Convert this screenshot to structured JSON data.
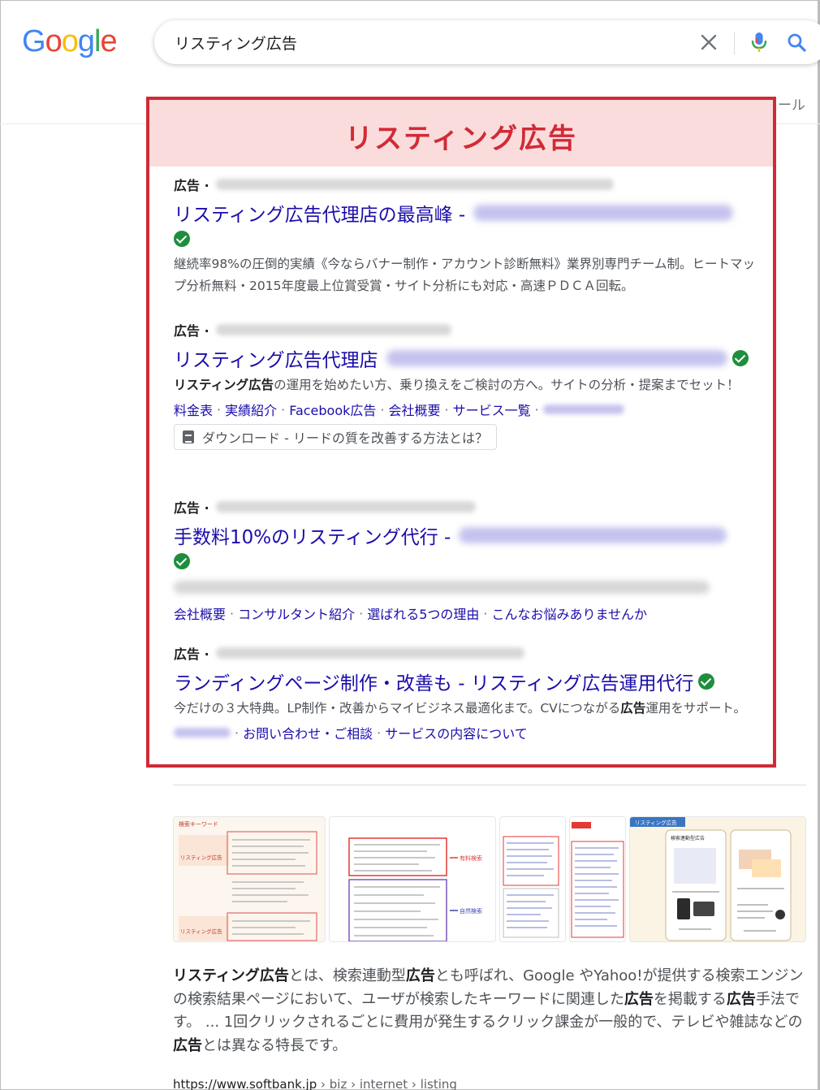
{
  "header": {
    "logo": {
      "letters": [
        "G",
        "o",
        "o",
        "g",
        "l",
        "e"
      ],
      "colors": [
        "#4285f4",
        "#ea4335",
        "#fbbc05",
        "#4285f4",
        "#34a853",
        "#ea4335"
      ]
    },
    "search_value": "リスティング広告",
    "tools_fragment": "ール"
  },
  "colors": {
    "accent_red": "#d12a36",
    "banner_bg": "#fbdcdc",
    "link_blue": "#1a0dab",
    "verified_green": "#1e8e3e"
  },
  "icons": {
    "clear": "close-icon",
    "mic": "mic-icon",
    "search": "search-icon",
    "verified": "check-icon",
    "download": "document-icon"
  },
  "banner": {
    "title": "リスティング広告"
  },
  "ads": [
    {
      "label": "広告 ·",
      "title": "リスティング広告代理店の最高峰 -",
      "desc": "継続率98%の圧倒的実績《今ならバナー制作・アカウント診断無料》業界別専門チーム制。ヒートマップ分析無料・2015年度最上位賞受賞・サイト分析にも対応・高速ＰＤＣＡ回転。"
    },
    {
      "label": "広告 ·",
      "title": "リスティング広告代理店",
      "desc_bold": "リスティング広告",
      "desc_rest": "の運用を始めたい方、乗り換えをご検討の方へ。サイトの分析・提案までセット！",
      "sitelinks": [
        "料金表",
        "実績紹介",
        "Facebook広告",
        "会社概要",
        "サービス一覧"
      ],
      "download": "ダウンロード - リードの質を改善する方法とは？"
    },
    {
      "label": "広告 ·",
      "title": "手数料10%のリスティング代行 -",
      "sitelinks": [
        "会社概要",
        "コンサルタント紹介",
        "選ばれる5つの理由",
        "こんなお悩みありませんか"
      ]
    },
    {
      "label": "広告 ·",
      "title": "ランディングページ制作・改善も - リスティング広告運用代行",
      "desc_a": "今だけの３大特典。LP制作・改善からマイビジネス最適化まで。CVにつながる",
      "desc_bold": "広告",
      "desc_b": "運用をサポート。",
      "sitelinks": [
        "お問い合わせ・ご相談",
        "サービスの内容について"
      ]
    }
  ],
  "thumbnails": {
    "t1_heading": "検索キーワード",
    "t1_label_a": "リスティング広告",
    "t1_label_b": "リスティング広告",
    "t2_label_a": "有料検索",
    "t2_label_b": "自然検索",
    "t5_heading": "リスティング広告",
    "t5_col": "検索連動型広告"
  },
  "snippet": {
    "p1_bold": "リスティング広告",
    "p1": "とは、検索連動型",
    "p2_bold": "広告",
    "p2": "とも呼ばれ、Google やYahoo!が提供する検索エンジンの検索結果ページにおいて、ユーザが検索したキーワードに関連した",
    "p3_bold": "広告",
    "p3": "を掲載する",
    "p4_bold": "広告",
    "p4": "手法です。 ... 1回クリックされるごとに費用が発生するクリック課金が一般的で、テレビや雑誌などの",
    "p5_bold": "広告",
    "p5": "とは異なる特長です。"
  },
  "result": {
    "domain": "https://www.softbank.jp",
    "crumbs": " › biz › internet › listing"
  }
}
